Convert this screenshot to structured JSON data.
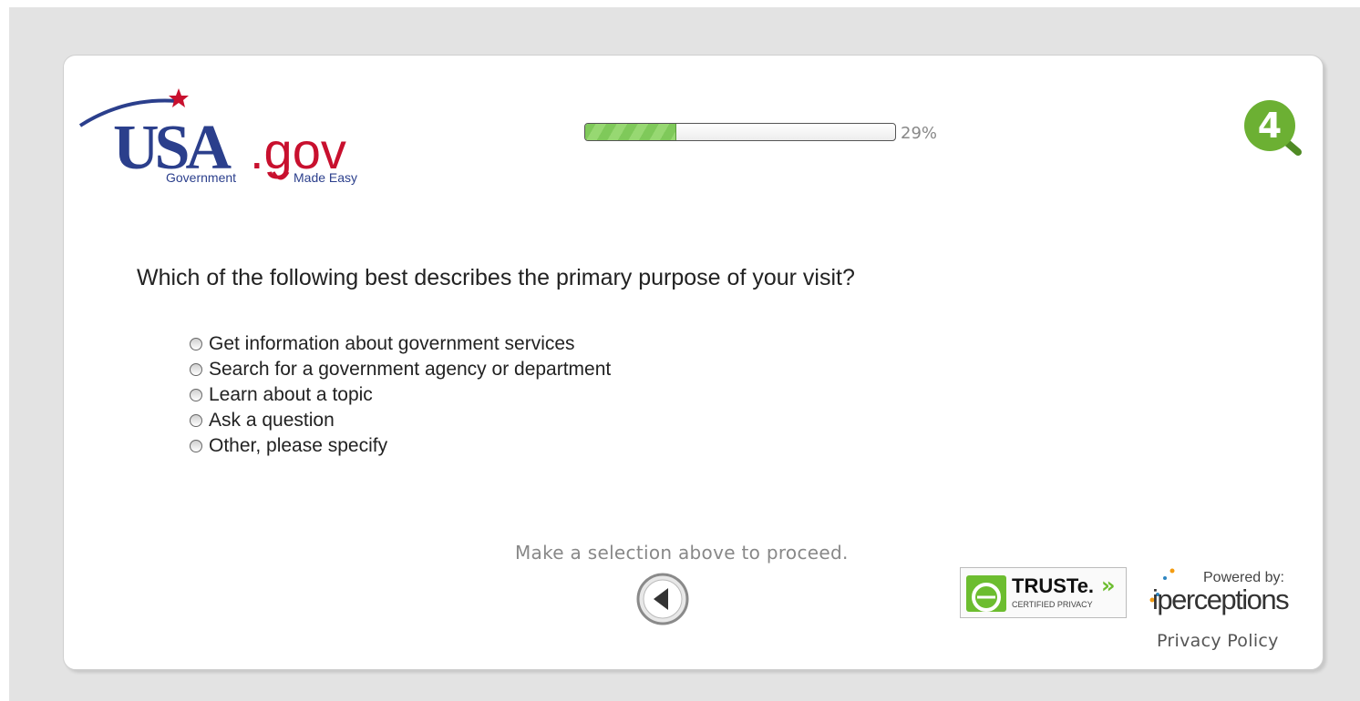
{
  "logo": {
    "main_text": "USA",
    "suffix_text": ".gov",
    "tagline_left": "Government",
    "tagline_right": "Made Easy"
  },
  "progress": {
    "fraction": 0.29,
    "label": "29%"
  },
  "badge": {
    "text": "4",
    "icon": "magnifier-badge-icon"
  },
  "question": "Which of the following best describes the primary purpose of your visit?",
  "options": [
    "Get information about government services",
    "Search for a government agency or department",
    "Learn about a topic",
    "Ask a question",
    "Other, please specify"
  ],
  "instruction": "Make a selection above to proceed.",
  "navigation": {
    "back_icon": "back-arrow-icon"
  },
  "footer": {
    "truste_name": "TRUSTe.",
    "truste_sub": "CERTIFIED PRIVACY",
    "truste_arrows": "»",
    "powered_by": "Powered by:",
    "brand": "iperceptions",
    "privacy_link": "Privacy Policy"
  },
  "colors": {
    "logo_blue": "#2b3f8c",
    "logo_red": "#c8102e",
    "progress_green": "#7fc95a",
    "badge_green": "#6cb033",
    "truste_green": "#6cbd2f"
  }
}
